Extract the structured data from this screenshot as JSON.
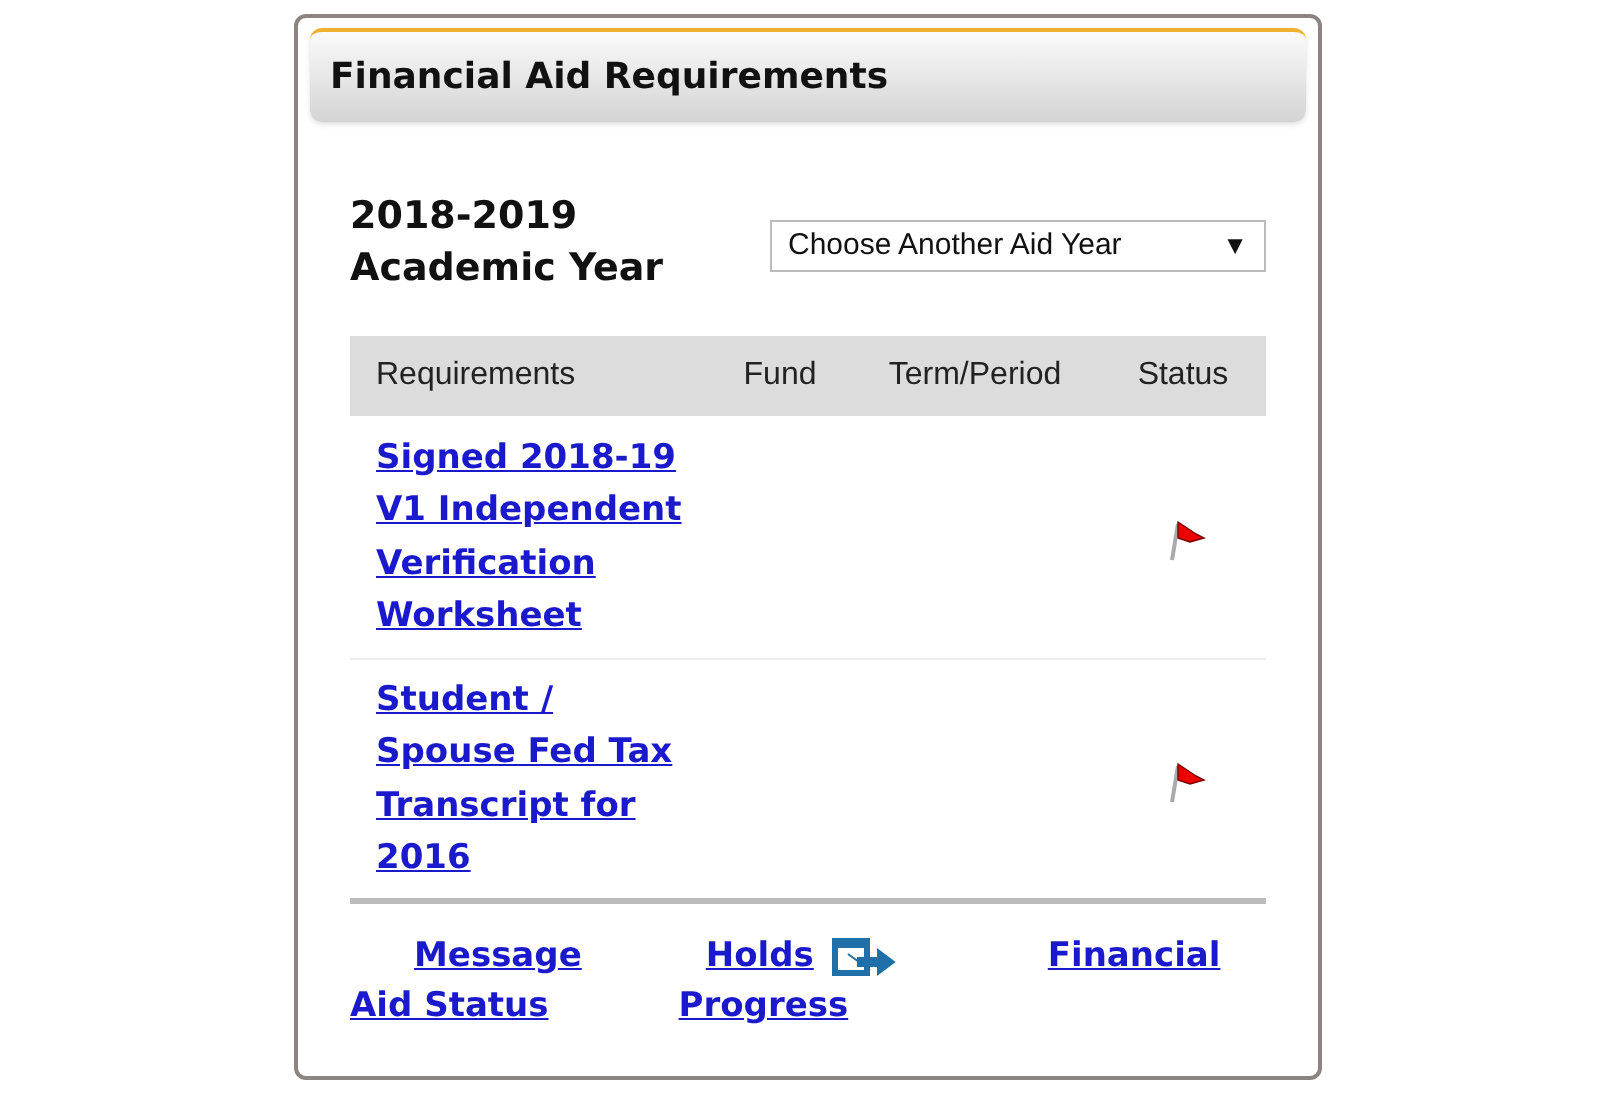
{
  "panel": {
    "title": "Financial Aid Requirements"
  },
  "aid_year": {
    "label": "2018-2019 Academic Year",
    "select": "Choose Another Aid Year",
    "caret": "▼"
  },
  "table": {
    "columns": [
      "Requirements",
      "Fund",
      "Term/Period",
      "Status"
    ],
    "rows": [
      {
        "requirement": "Signed 2018-19 V1 Independent Verification Worksheet",
        "flagged": true
      },
      {
        "requirement": "Student / Spouse Fed Tax Transcript for 2016",
        "flagged": true
      }
    ]
  },
  "footer_links": [
    [
      "Message",
      "Holds",
      "Financial"
    ],
    [
      "Aid Status",
      "Progress"
    ]
  ]
}
